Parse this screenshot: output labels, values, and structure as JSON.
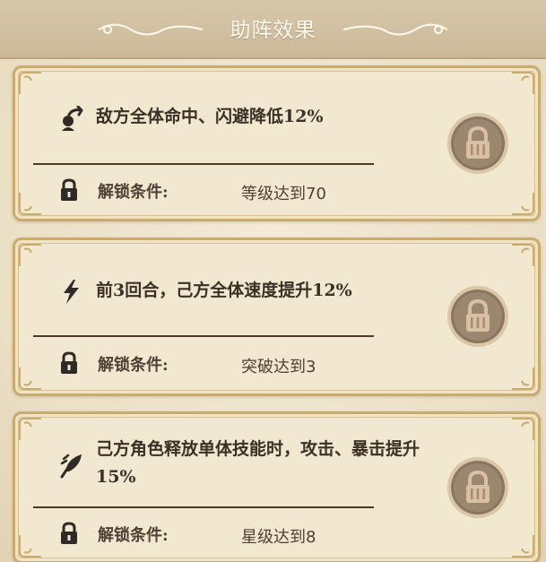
{
  "header": {
    "title": "助阵效果"
  },
  "cards": [
    {
      "effect_icon": "target-strike-icon",
      "effect": "敌方全体命中、闪避降低12%",
      "unlock_label": "解锁条件:",
      "unlock_condition": "等级达到70",
      "locked": true
    },
    {
      "effect_icon": "lightning-bolt-icon",
      "effect": "前3回合，己方全体速度提升12%",
      "unlock_label": "解锁条件:",
      "unlock_condition": "突破达到3",
      "locked": true
    },
    {
      "effect_icon": "feather-quill-icon",
      "effect": "己方角色释放单体技能时，攻击、暴击提升15%",
      "unlock_label": "解锁条件:",
      "unlock_condition": "星级达到8",
      "locked": true
    }
  ],
  "colors": {
    "frame_gold": "#c8ab6f",
    "parchment": "#f2e7cf",
    "text_dark": "#3b2f26",
    "lock_badge": "#8a7660"
  }
}
